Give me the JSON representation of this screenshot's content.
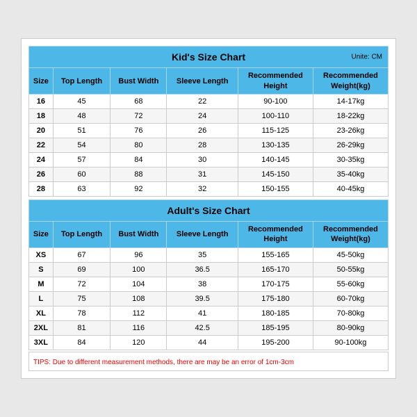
{
  "kids_chart": {
    "title": "Kid's Size Chart",
    "unit": "Unite: CM",
    "headers": [
      "Size",
      "Top Length",
      "Bust Width",
      "Sleeve Length",
      "Recommended\nHeight",
      "Recommended\nWeight(kg)"
    ],
    "rows": [
      [
        "16",
        "45",
        "68",
        "22",
        "90-100",
        "14-17kg"
      ],
      [
        "18",
        "48",
        "72",
        "24",
        "100-110",
        "18-22kg"
      ],
      [
        "20",
        "51",
        "76",
        "26",
        "115-125",
        "23-26kg"
      ],
      [
        "22",
        "54",
        "80",
        "28",
        "130-135",
        "26-29kg"
      ],
      [
        "24",
        "57",
        "84",
        "30",
        "140-145",
        "30-35kg"
      ],
      [
        "26",
        "60",
        "88",
        "31",
        "145-150",
        "35-40kg"
      ],
      [
        "28",
        "63",
        "92",
        "32",
        "150-155",
        "40-45kg"
      ]
    ]
  },
  "adults_chart": {
    "title": "Adult's Size Chart",
    "headers": [
      "Size",
      "Top Length",
      "Bust Width",
      "Sleeve Length",
      "Recommended\nHeight",
      "Recommended\nWeight(kg)"
    ],
    "rows": [
      [
        "XS",
        "67",
        "96",
        "35",
        "155-165",
        "45-50kg"
      ],
      [
        "S",
        "69",
        "100",
        "36.5",
        "165-170",
        "50-55kg"
      ],
      [
        "M",
        "72",
        "104",
        "38",
        "170-175",
        "55-60kg"
      ],
      [
        "L",
        "75",
        "108",
        "39.5",
        "175-180",
        "60-70kg"
      ],
      [
        "XL",
        "78",
        "112",
        "41",
        "180-185",
        "70-80kg"
      ],
      [
        "2XL",
        "81",
        "116",
        "42.5",
        "185-195",
        "80-90kg"
      ],
      [
        "3XL",
        "84",
        "120",
        "44",
        "195-200",
        "90-100kg"
      ]
    ]
  },
  "tips": "TIPS: Due to different measurement methods, there are may be an error of 1cm-3cm"
}
